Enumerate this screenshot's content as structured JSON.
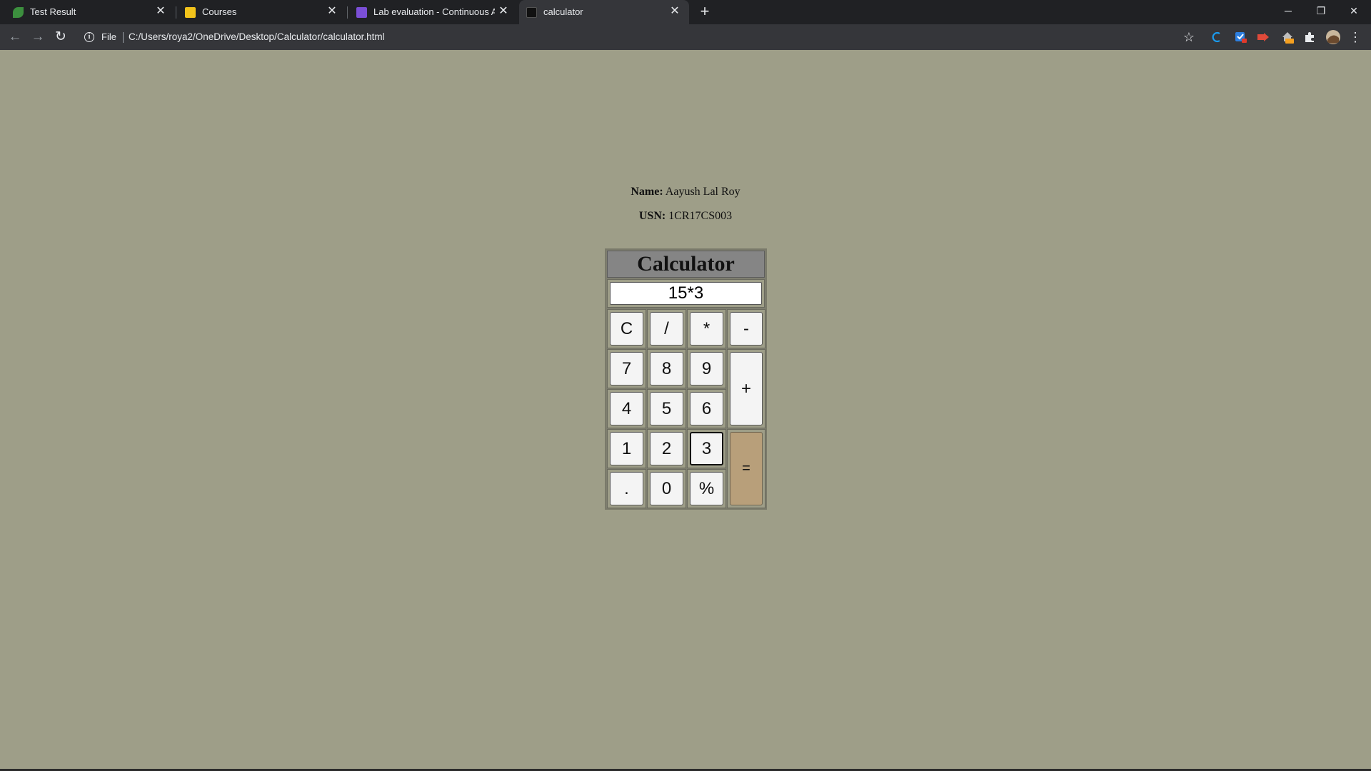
{
  "browser": {
    "tabs": [
      {
        "title": "Test Result",
        "favicon_color": "#3c8f3e",
        "icon": "leaf-icon",
        "active": false
      },
      {
        "title": "Courses",
        "favicon_color": "#f2c31b",
        "icon": "classroom-icon",
        "active": false
      },
      {
        "title": "Lab evaluation - Continuous Ass",
        "favicon_color": "#7b4fd6",
        "icon": "forms-icon",
        "active": false
      },
      {
        "title": "calculator",
        "favicon_color": "#111111",
        "icon": "page-icon",
        "active": true
      }
    ],
    "new_tab_label": "+",
    "close_glyph": "✕",
    "window_controls": {
      "minimize": "─",
      "restore": "❐",
      "close": "✕"
    },
    "toolbar": {
      "back": "←",
      "forward": "→",
      "reload": "↻",
      "info_glyph": "i",
      "chip_label": "File",
      "url": "C:/Users/roya2/OneDrive/Desktop/Calculator/calculator.html",
      "star": "☆",
      "menu": "⋮"
    },
    "extensions": [
      {
        "name": "c-extension-icon",
        "color": "#1a9cf0"
      },
      {
        "name": "checkbox-extension-icon",
        "color": "#2d7fe0"
      },
      {
        "name": "arrow-extension-icon",
        "color": "#e04a3a"
      },
      {
        "name": "home-off-extension-icon",
        "color": "#f5a020"
      },
      {
        "name": "puzzle-extensions-icon",
        "color": "#e8eaed"
      }
    ]
  },
  "page": {
    "name_label": "Name:",
    "name_value": "Aayush Lal Roy",
    "usn_label": "USN:",
    "usn_value": "1CR17CS003"
  },
  "calculator": {
    "title": "Calculator",
    "display_value": "15*3",
    "keys": {
      "clear": "C",
      "divide": "/",
      "multiply": "*",
      "minus": "-",
      "seven": "7",
      "eight": "8",
      "nine": "9",
      "plus": "+",
      "four": "4",
      "five": "5",
      "six": "6",
      "one": "1",
      "two": "2",
      "three": "3",
      "equals": "=",
      "dot": ".",
      "zero": "0",
      "percent": "%"
    },
    "colors": {
      "page_bg": "#9e9e88",
      "title_bg": "#858585",
      "equals_bg": "#b89f7a",
      "key_bg": "#f4f4f4"
    }
  }
}
